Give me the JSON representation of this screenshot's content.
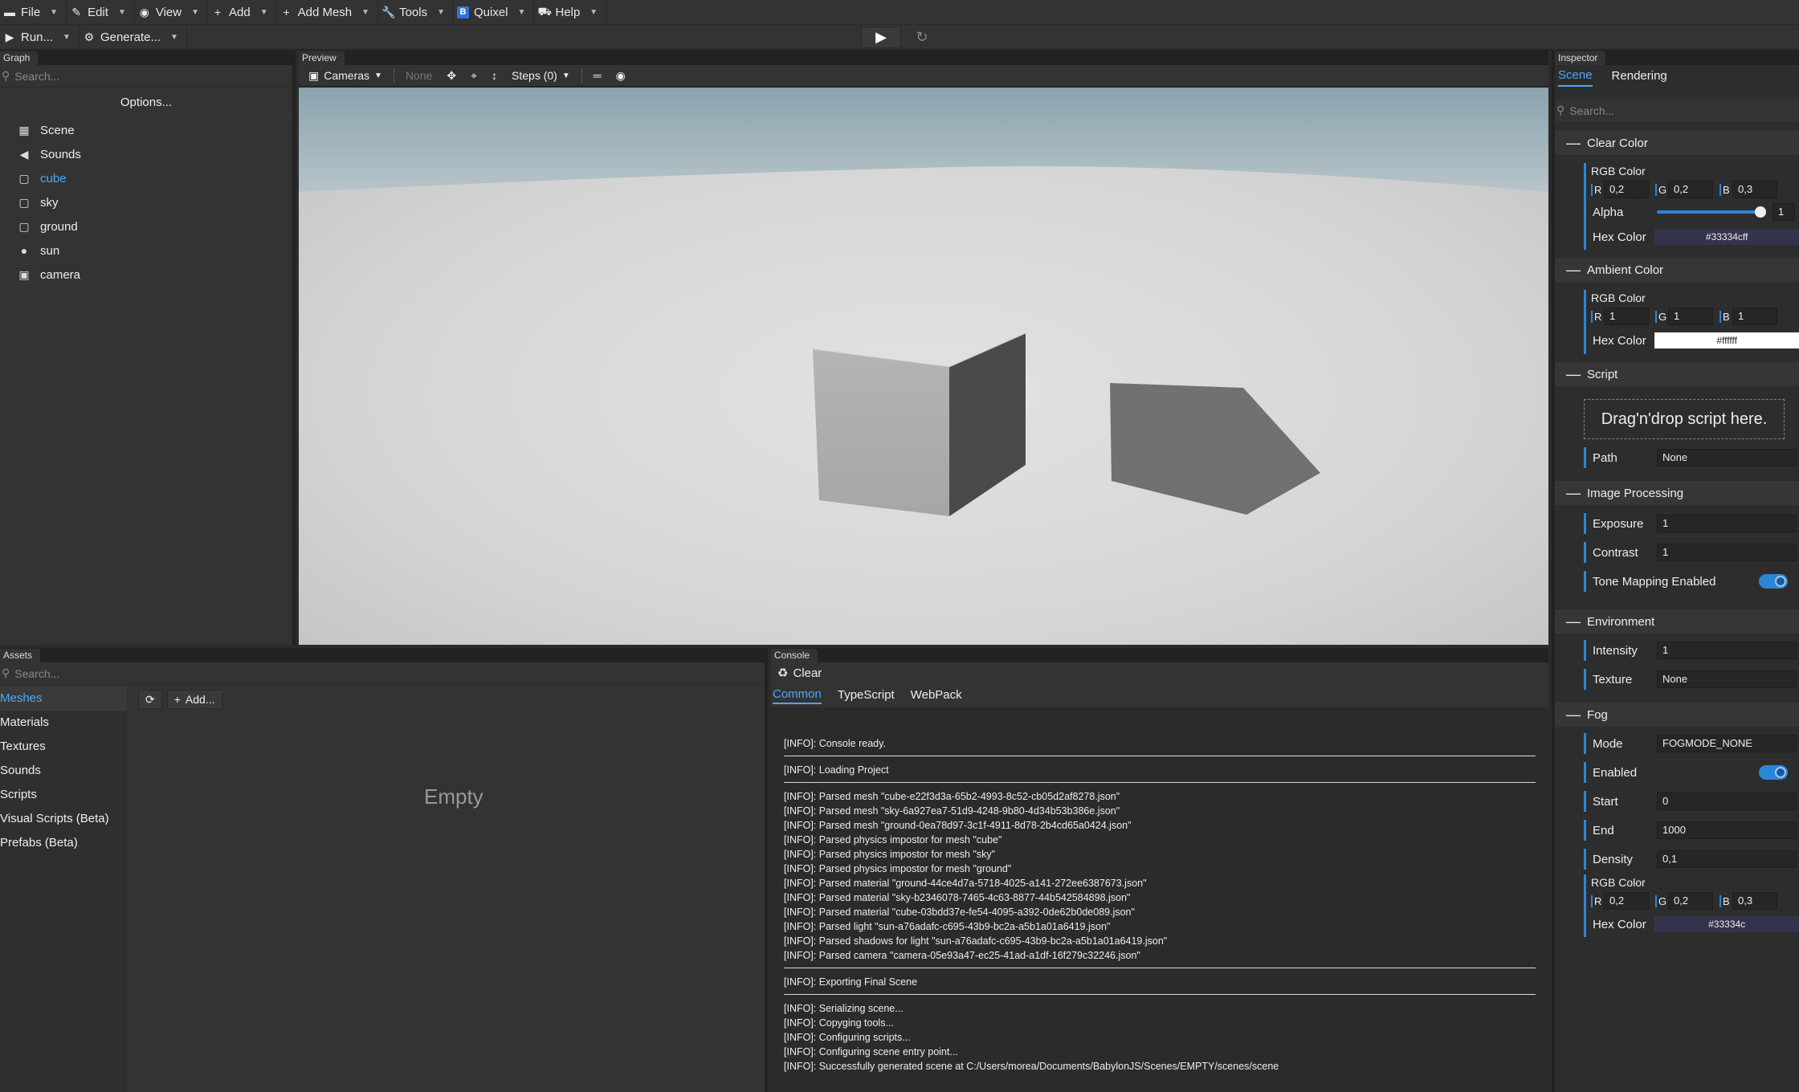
{
  "menu": {
    "file": "File",
    "edit": "Edit",
    "view": "View",
    "add": "Add",
    "add_mesh": "Add Mesh",
    "tools": "Tools",
    "quixel": "Quixel",
    "help": "Help"
  },
  "runbar": {
    "run": "Run...",
    "generate": "Generate..."
  },
  "graph": {
    "tab": "Graph",
    "search_placeholder": "Search...",
    "options": "Options...",
    "items": [
      {
        "label": "Scene",
        "icon": "scene-icon"
      },
      {
        "label": "Sounds",
        "icon": "speaker-icon"
      },
      {
        "label": "cube",
        "icon": "mesh-icon",
        "selected": true
      },
      {
        "label": "sky",
        "icon": "mesh-icon"
      },
      {
        "label": "ground",
        "icon": "mesh-icon"
      },
      {
        "label": "sun",
        "icon": "light-bulb-icon"
      },
      {
        "label": "camera",
        "icon": "camera-icon"
      }
    ]
  },
  "preview": {
    "tab": "Preview",
    "cameras": "Cameras",
    "none": "None",
    "steps": "Steps (0)"
  },
  "inspector": {
    "tab": "Inspector",
    "tabs": [
      "Scene",
      "Rendering"
    ],
    "search_placeholder": "Search...",
    "clear_color": {
      "title": "Clear Color",
      "rgb_label": "RGB Color",
      "r": "0,2",
      "g": "0,2",
      "b": "0,3",
      "alpha_label": "Alpha",
      "alpha": "1",
      "hex_label": "Hex Color",
      "hex": "#33334cff",
      "hex_bg": "#33334c"
    },
    "ambient_color": {
      "title": "Ambient Color",
      "rgb_label": "RGB Color",
      "r": "1",
      "g": "1",
      "b": "1",
      "hex_label": "Hex Color",
      "hex": "#ffffff",
      "hex_bg": "#ffffff"
    },
    "script": {
      "title": "Script",
      "dropzone": "Drag'n'drop script here.",
      "path_label": "Path",
      "path": "None"
    },
    "image_processing": {
      "title": "Image Processing",
      "exposure_label": "Exposure",
      "exposure": "1",
      "contrast_label": "Contrast",
      "contrast": "1",
      "tone_mapping_label": "Tone Mapping Enabled"
    },
    "environment": {
      "title": "Environment",
      "intensity_label": "Intensity",
      "intensity": "1",
      "texture_label": "Texture",
      "texture": "None"
    },
    "fog": {
      "title": "Fog",
      "mode_label": "Mode",
      "mode": "FOGMODE_NONE",
      "enabled_label": "Enabled",
      "start_label": "Start",
      "start": "0",
      "end_label": "End",
      "end": "1000",
      "density_label": "Density",
      "density": "0,1",
      "rgb_label": "RGB Color",
      "r": "0,2",
      "g": "0,2",
      "b": "0,3",
      "hex_label": "Hex Color",
      "hex": "#33334c",
      "hex_bg": "#33334c"
    }
  },
  "assets": {
    "tab": "Assets",
    "search_placeholder": "Search...",
    "categories": [
      "Meshes",
      "Materials",
      "Textures",
      "Sounds",
      "Scripts",
      "Visual Scripts (Beta)",
      "Prefabs (Beta)"
    ],
    "add": "Add...",
    "empty": "Empty"
  },
  "console": {
    "tab": "Console",
    "clear": "Clear",
    "tabs": [
      "Common",
      "TypeScript",
      "WebPack"
    ],
    "groups": [
      [
        "[INFO]: Console ready."
      ],
      [
        "[INFO]: Loading Project"
      ],
      [
        "[INFO]: Parsed mesh \"cube-e22f3d3a-65b2-4993-8c52-cb05d2af8278.json\"",
        "[INFO]: Parsed mesh \"sky-6a927ea7-51d9-4248-9b80-4d34b53b386e.json\"",
        "[INFO]: Parsed mesh \"ground-0ea78d97-3c1f-4911-8d78-2b4cd65a0424.json\"",
        "[INFO]: Parsed physics impostor for mesh \"cube\"",
        "[INFO]: Parsed physics impostor for mesh \"sky\"",
        "[INFO]: Parsed physics impostor for mesh \"ground\"",
        "[INFO]: Parsed material \"ground-44ce4d7a-5718-4025-a141-272ee6387673.json\"",
        "[INFO]: Parsed material \"sky-b2346078-7465-4c63-8877-44b542584898.json\"",
        "[INFO]: Parsed material \"cube-03bdd37e-fe54-4095-a392-0de62b0de089.json\"",
        "[INFO]: Parsed light \"sun-a76adafc-c695-43b9-bc2a-a5b1a01a6419.json\"",
        "[INFO]: Parsed shadows for light \"sun-a76adafc-c695-43b9-bc2a-a5b1a01a6419.json\"",
        "[INFO]: Parsed camera \"camera-05e93a47-ec25-41ad-a1df-16f279c32246.json\""
      ],
      [
        "[INFO]: Exporting Final Scene"
      ],
      [
        "[INFO]: Serializing scene...",
        "[INFO]: Copyging tools...",
        "[INFO]: Configuring scripts...",
        "[INFO]: Configuring scene entry point...",
        "[INFO]: Successfully generated scene at C:/Users/morea/Documents/BabylonJS/Scenes/EMPTY/scenes/scene"
      ]
    ]
  }
}
